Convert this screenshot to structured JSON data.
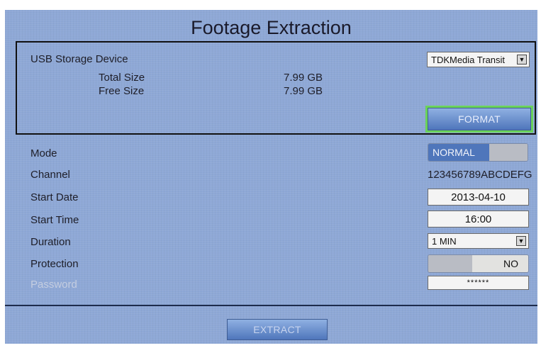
{
  "title": "Footage Extraction",
  "usb": {
    "label": "USB Storage Device",
    "total_label": "Total Size",
    "total_value": "7.99 GB",
    "free_label": "Free Size",
    "free_value": "7.99 GB",
    "device": "TDKMedia Transit",
    "format_button": "FORMAT"
  },
  "form": {
    "mode_label": "Mode",
    "mode_value": "NORMAL",
    "channel_label": "Channel",
    "channel_value": "123456789ABCDEFG",
    "start_date_label": "Start Date",
    "start_date_value": "2013-04-10",
    "start_time_label": "Start Time",
    "start_time_value": "16:00",
    "duration_label": "Duration",
    "duration_value": "1 MIN",
    "protection_label": "Protection",
    "protection_value": "NO",
    "password_label": "Password",
    "password_value": "******"
  },
  "extract_button": "EXTRACT",
  "icons": {
    "dropdown": "dropdown-arrow-icon"
  },
  "colors": {
    "panel": "#8ea8d6",
    "button": "#4f76bb",
    "format_highlight": "#6ad35a"
  }
}
